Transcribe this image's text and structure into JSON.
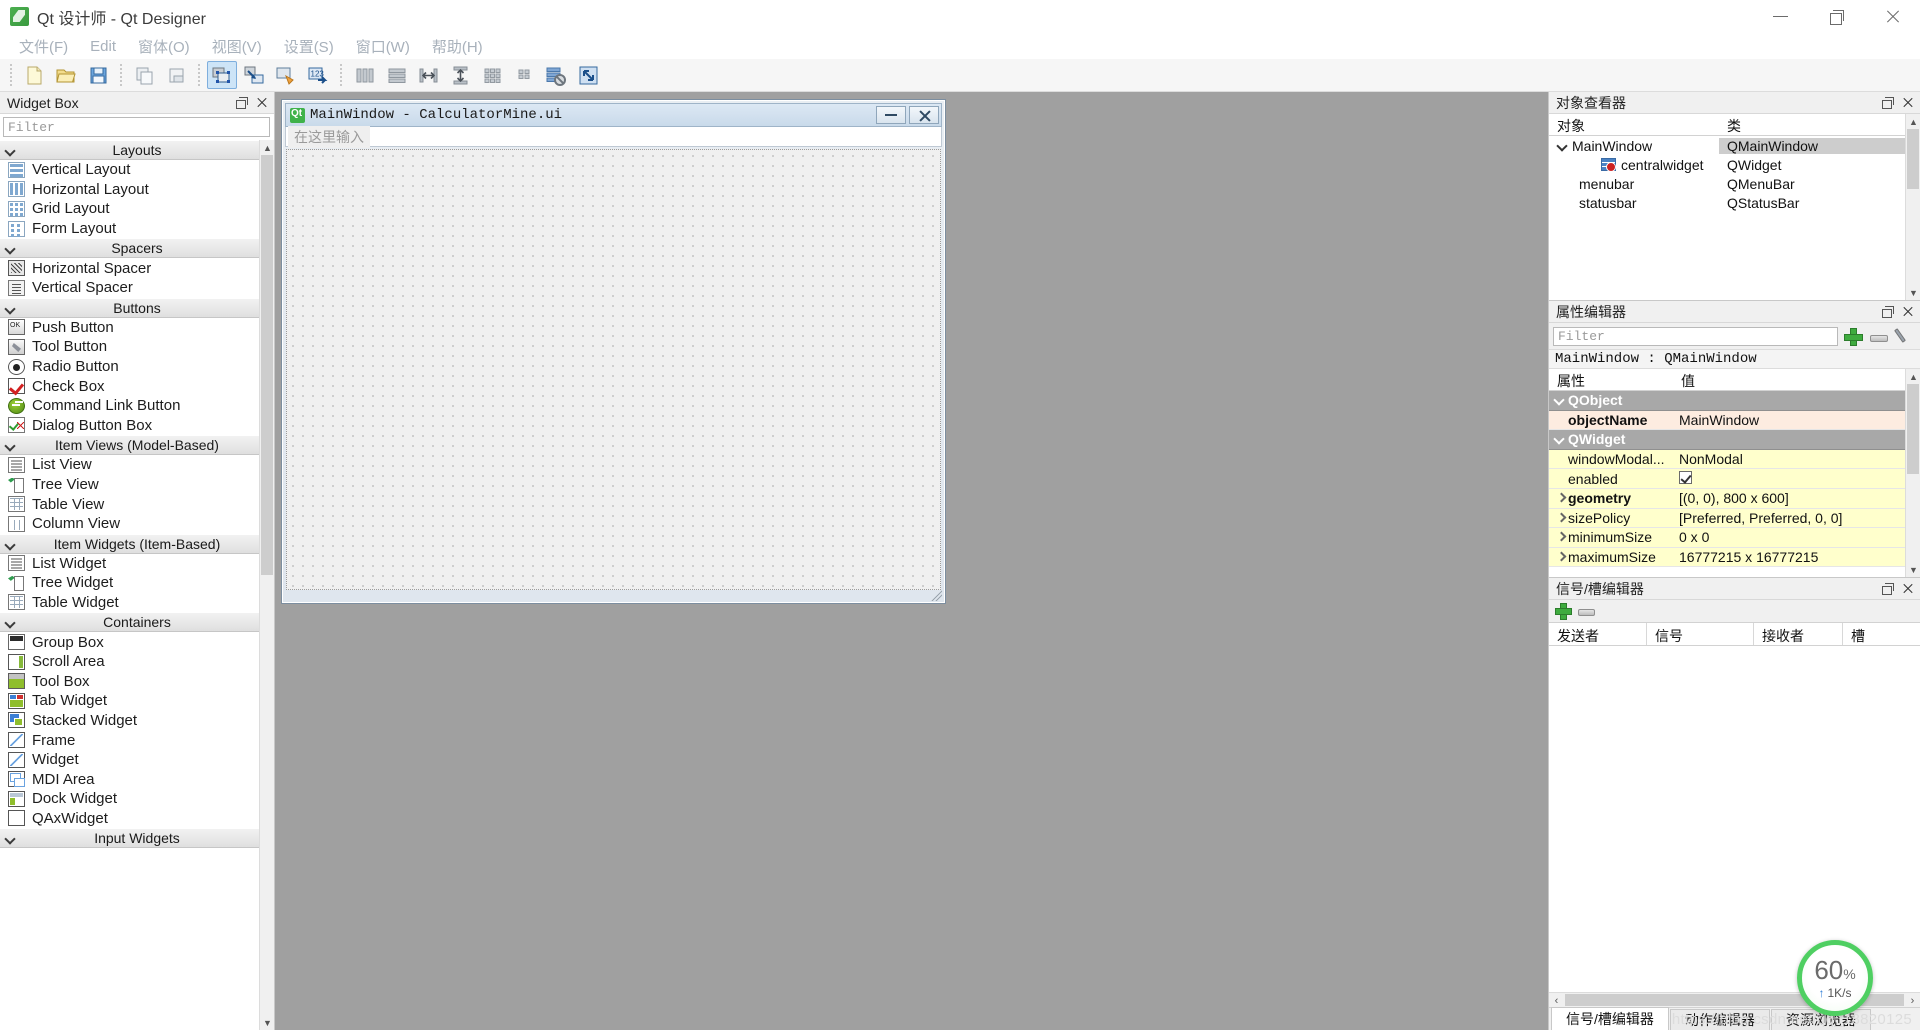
{
  "window": {
    "title": "Qt 设计师 - Qt Designer",
    "icon": "qt-designer-icon",
    "minimize": "—",
    "maximize": "❐",
    "close": "✕"
  },
  "menubar": {
    "items": [
      {
        "label": "文件(F)",
        "name": "menu-file"
      },
      {
        "label": "Edit",
        "name": "menu-edit"
      },
      {
        "label": "窗体(O)",
        "name": "menu-form"
      },
      {
        "label": "视图(V)",
        "name": "menu-view"
      },
      {
        "label": "设置(S)",
        "name": "menu-settings"
      },
      {
        "label": "窗口(W)",
        "name": "menu-window"
      },
      {
        "label": "帮助(H)",
        "name": "menu-help"
      }
    ]
  },
  "toolbar": {
    "groups": [
      [
        "new-file-icon",
        "open-file-icon",
        "save-file-icon"
      ],
      [
        "copy-icon",
        "paste-icon"
      ],
      [
        "edit-widgets-icon",
        "edit-signals-slots-icon",
        "edit-buddies-icon",
        "edit-tab-order-icon"
      ],
      [
        "layout-horizontally-icon",
        "layout-vertically-icon",
        "layout-in-splitter-horizontal-icon",
        "layout-in-splitter-vertical-icon",
        "layout-grid-icon",
        "layout-form-icon",
        "break-layout-icon",
        "adjust-size-icon"
      ]
    ],
    "active_tool": "edit-widgets-icon"
  },
  "widget_box": {
    "title": "Widget Box",
    "filter_placeholder": "Filter",
    "filter_value": "",
    "float_label": "float",
    "close_label": "close",
    "categories": [
      {
        "name": "Layouts",
        "label": "Layouts",
        "items": [
          {
            "label": "Vertical Layout",
            "icon": "vertical-layout-icon",
            "cls": "ico-vlayout"
          },
          {
            "label": "Horizontal Layout",
            "icon": "horizontal-layout-icon",
            "cls": "ico-hlayout"
          },
          {
            "label": "Grid Layout",
            "icon": "grid-layout-icon",
            "cls": "ico-grid"
          },
          {
            "label": "Form Layout",
            "icon": "form-layout-icon",
            "cls": "ico-form"
          }
        ]
      },
      {
        "name": "Spacers",
        "label": "Spacers",
        "items": [
          {
            "label": "Horizontal Spacer",
            "icon": "horizontal-spacer-icon",
            "cls": "ico-hspacer"
          },
          {
            "label": "Vertical Spacer",
            "icon": "vertical-spacer-icon",
            "cls": "ico-vspacer"
          }
        ]
      },
      {
        "name": "Buttons",
        "label": "Buttons",
        "items": [
          {
            "label": "Push Button",
            "icon": "push-button-icon",
            "cls": "ico-push"
          },
          {
            "label": "Tool Button",
            "icon": "tool-button-icon",
            "cls": "ico-tool"
          },
          {
            "label": "Radio Button",
            "icon": "radio-button-icon",
            "cls": "ico-radio"
          },
          {
            "label": "Check Box",
            "icon": "check-box-icon",
            "cls": "ico-check"
          },
          {
            "label": "Command Link Button",
            "icon": "command-link-button-icon",
            "cls": "ico-cmdlink"
          },
          {
            "label": "Dialog Button Box",
            "icon": "dialog-button-box-icon",
            "cls": "ico-dlgbtn"
          }
        ]
      },
      {
        "name": "Item Views (Model-Based)",
        "label": "Item Views (Model-Based)",
        "items": [
          {
            "label": "List View",
            "icon": "list-view-icon",
            "cls": "ico-listv"
          },
          {
            "label": "Tree View",
            "icon": "tree-view-icon",
            "cls": "ico-treev"
          },
          {
            "label": "Table View",
            "icon": "table-view-icon",
            "cls": "ico-tablev"
          },
          {
            "label": "Column View",
            "icon": "column-view-icon",
            "cls": "ico-colv"
          }
        ]
      },
      {
        "name": "Item Widgets (Item-Based)",
        "label": "Item Widgets (Item-Based)",
        "items": [
          {
            "label": "List Widget",
            "icon": "list-widget-icon",
            "cls": "ico-listv"
          },
          {
            "label": "Tree Widget",
            "icon": "tree-widget-icon",
            "cls": "ico-treev"
          },
          {
            "label": "Table Widget",
            "icon": "table-widget-icon",
            "cls": "ico-tablev"
          }
        ]
      },
      {
        "name": "Containers",
        "label": "Containers",
        "items": [
          {
            "label": "Group Box",
            "icon": "group-box-icon",
            "cls": "ico-groupbox"
          },
          {
            "label": "Scroll Area",
            "icon": "scroll-area-icon",
            "cls": "ico-scroll"
          },
          {
            "label": "Tool Box",
            "icon": "tool-box-icon",
            "cls": "ico-toolbox"
          },
          {
            "label": "Tab Widget",
            "icon": "tab-widget-icon",
            "cls": "ico-tabw"
          },
          {
            "label": "Stacked Widget",
            "icon": "stacked-widget-icon",
            "cls": "ico-stacked"
          },
          {
            "label": "Frame",
            "icon": "frame-icon",
            "cls": "ico-frame"
          },
          {
            "label": "Widget",
            "icon": "widget-icon",
            "cls": "ico-widget"
          },
          {
            "label": "MDI Area",
            "icon": "mdi-area-icon",
            "cls": "ico-mdi"
          },
          {
            "label": "Dock Widget",
            "icon": "dock-widget-icon",
            "cls": "ico-dock"
          },
          {
            "label": "QAxWidget",
            "icon": "qax-widget-icon",
            "cls": "ico-qax"
          }
        ]
      },
      {
        "name": "Input Widgets",
        "label": "Input Widgets",
        "items": []
      }
    ]
  },
  "form": {
    "title": "MainWindow - CalculatorMine.ui",
    "icon": "qt-logo-icon",
    "menu_placeholder": "在这里输入",
    "minimize_label": "minimize",
    "close_label": "close"
  },
  "object_inspector": {
    "title": "对象查看器",
    "columns": [
      "对象",
      "类"
    ],
    "rows": [
      {
        "object": "MainWindow",
        "class": "QMainWindow",
        "indent": 0,
        "expandable": true,
        "selected": true,
        "icon": ""
      },
      {
        "object": "centralwidget",
        "class": "QWidget",
        "indent": 2,
        "expandable": false,
        "selected": false,
        "icon": "central-widget-icon"
      },
      {
        "object": "menubar",
        "class": "QMenuBar",
        "indent": 1,
        "expandable": false,
        "selected": false,
        "icon": ""
      },
      {
        "object": "statusbar",
        "class": "QStatusBar",
        "indent": 1,
        "expandable": false,
        "selected": false,
        "icon": ""
      }
    ]
  },
  "property_editor": {
    "title": "属性编辑器",
    "filter_placeholder": "Filter",
    "filter_value": "",
    "object_line": "MainWindow : QMainWindow",
    "columns": [
      "属性",
      "值"
    ],
    "rows": [
      {
        "name": "QObject",
        "value": "",
        "kind": "group"
      },
      {
        "name": "objectName",
        "value": "MainWindow",
        "kind": "peach"
      },
      {
        "name": "QWidget",
        "value": "",
        "kind": "group"
      },
      {
        "name": "windowModal...",
        "value": "NonModal",
        "kind": "yellow"
      },
      {
        "name": "enabled",
        "value": "",
        "kind": "yellow",
        "checkbox": true
      },
      {
        "name": "geometry",
        "value": "[(0, 0), 800 x 600]",
        "kind": "yellow",
        "expandable": true,
        "bold": true
      },
      {
        "name": "sizePolicy",
        "value": "[Preferred, Preferred, 0, 0]",
        "kind": "yellow",
        "expandable": true
      },
      {
        "name": "minimumSize",
        "value": "0 x 0",
        "kind": "yellow",
        "expandable": true
      },
      {
        "name": "maximumSize",
        "value": "16777215 x 16777215",
        "kind": "yellow",
        "expandable": true
      }
    ]
  },
  "signal_slot_editor": {
    "title": "信号/槽编辑器",
    "add_label": "add",
    "remove_label": "remove",
    "columns": [
      "发送者",
      "信号",
      "接收者",
      "槽"
    ],
    "rows": []
  },
  "bottom_tabs": {
    "tabs": [
      {
        "label": "信号/槽编辑器",
        "active": true
      },
      {
        "label": "动作编辑器",
        "active": false
      },
      {
        "label": "资源浏览器",
        "active": false
      }
    ]
  },
  "net_speed": {
    "percent": "60",
    "percent_symbol": "%",
    "rate": "1K/s",
    "arrow": "↑",
    "accent": "#4fcf62"
  },
  "watermark": {
    "text": "https://blog.csdn.net/qq_18820125"
  },
  "scroll": {
    "left_arrow": "‹",
    "right_arrow": "›",
    "up_arrow": "⌃",
    "down_arrow": "⌄"
  }
}
